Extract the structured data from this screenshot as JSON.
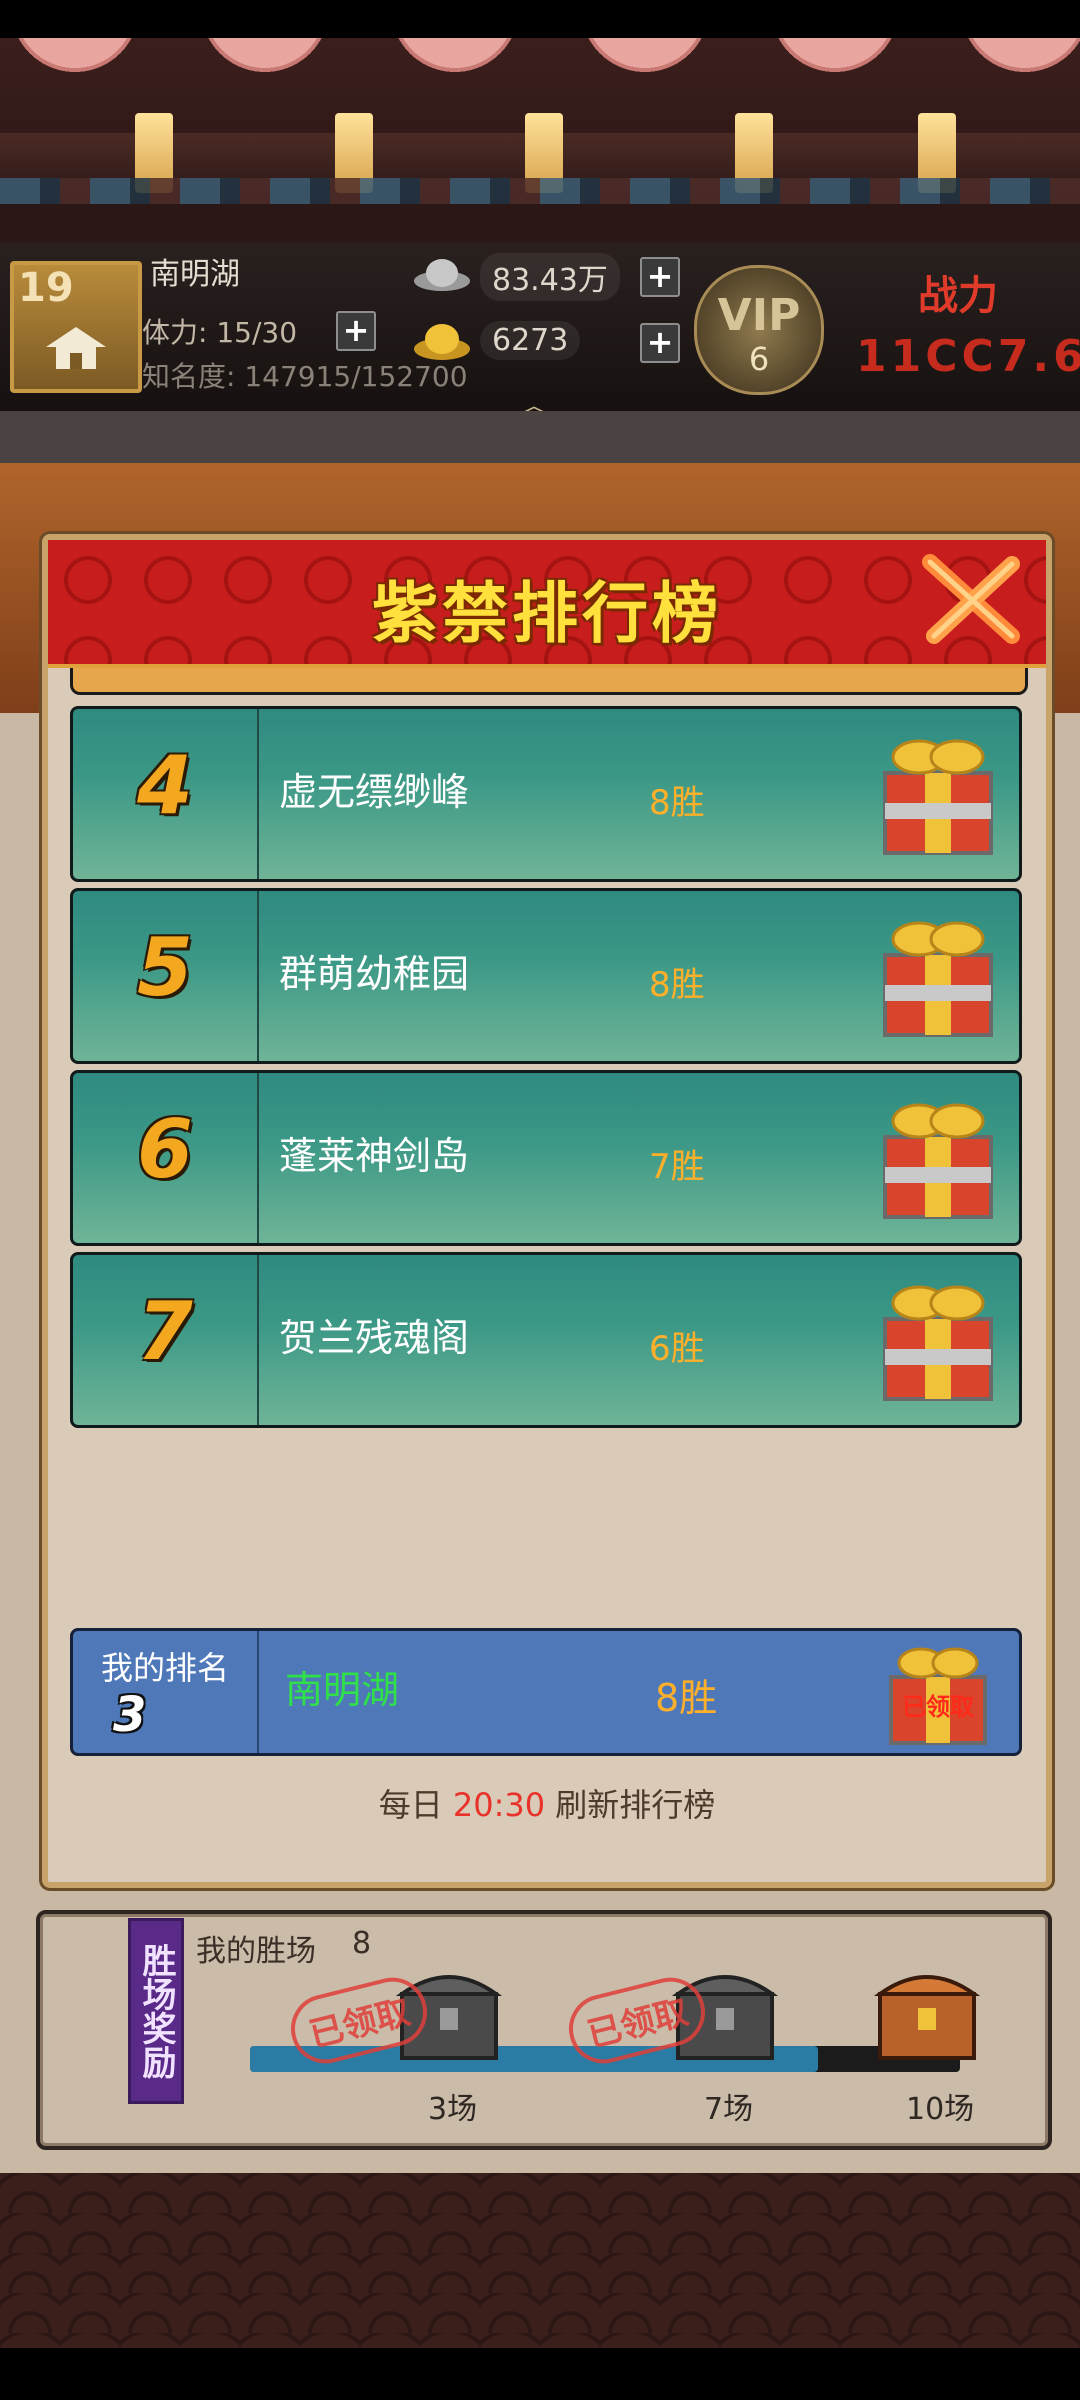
{
  "header": {
    "avatar_level": "19",
    "player_name": "南明湖",
    "stamina": "体力: 15/30",
    "fame": "知名度: 147915/152700",
    "silver": "83.43万",
    "gold": "6273",
    "vip_text": "VIP",
    "vip_level": "6",
    "power_label": "战力",
    "power_value": "11CC7.6",
    "plus": "+",
    "collapse": "︽"
  },
  "modal": {
    "title": "紫禁排行榜",
    "rows": [
      {
        "rank": "4",
        "name": "虚无缥缈峰",
        "wins": "8胜"
      },
      {
        "rank": "5",
        "name": "群萌幼稚园",
        "wins": "8胜"
      },
      {
        "rank": "6",
        "name": "蓬莱神剑岛",
        "wins": "7胜"
      },
      {
        "rank": "7",
        "name": "贺兰残魂阁",
        "wins": "6胜"
      }
    ],
    "my_rank": {
      "label": "我的排名",
      "rank": "3",
      "name": "南明湖",
      "wins": "8胜",
      "gift_stamp": "已领取"
    },
    "refresh": {
      "prefix": "每日",
      "time": "20:30",
      "suffix": "刷新排行榜"
    }
  },
  "rewards": {
    "tag": "胜场奖励",
    "my_wins_label": "我的胜场",
    "my_wins_count": "8",
    "progress": 0.8,
    "claimed_label": "已领取",
    "milestones": [
      {
        "label": "3场",
        "claimed": true
      },
      {
        "label": "7场",
        "claimed": true
      },
      {
        "label": "10场",
        "claimed": false
      }
    ]
  },
  "colors": {
    "accent_gold": "#ffe03c",
    "row_teal": "#3b9886",
    "my_row_blue": "#4e78b8",
    "win_orange": "#ffb02a",
    "refresh_red": "#e8322a"
  }
}
